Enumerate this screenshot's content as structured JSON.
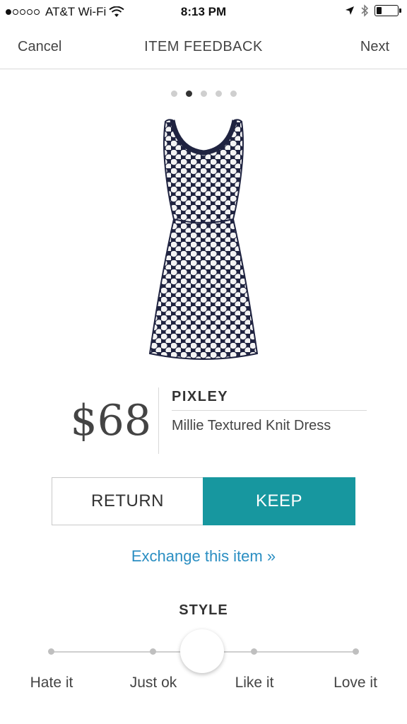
{
  "status_bar": {
    "carrier": "AT&T Wi-Fi",
    "time": "8:13 PM",
    "signal_bars": 1,
    "signal_total": 5,
    "battery_level": 0.25,
    "icons": [
      "wifi-icon",
      "location-arrow-icon",
      "bluetooth-icon",
      "battery-icon"
    ]
  },
  "nav": {
    "cancel_label": "Cancel",
    "title": "ITEM FEEDBACK",
    "next_label": "Next"
  },
  "pager": {
    "total": 5,
    "active_index": 1
  },
  "item": {
    "price": "$68",
    "brand": "PIXLEY",
    "name": "Millie Textured Knit Dress",
    "image": "navy-white-dot-dress"
  },
  "actions": {
    "return_label": "RETURN",
    "keep_label": "KEEP",
    "keep_color": "#17979f",
    "exchange_label": "Exchange this item »",
    "link_color": "#2a8ec2"
  },
  "style_rating": {
    "title": "STYLE",
    "options": [
      "Hate it",
      "Just ok",
      "Like it",
      "Love it"
    ],
    "value": 0.5
  }
}
